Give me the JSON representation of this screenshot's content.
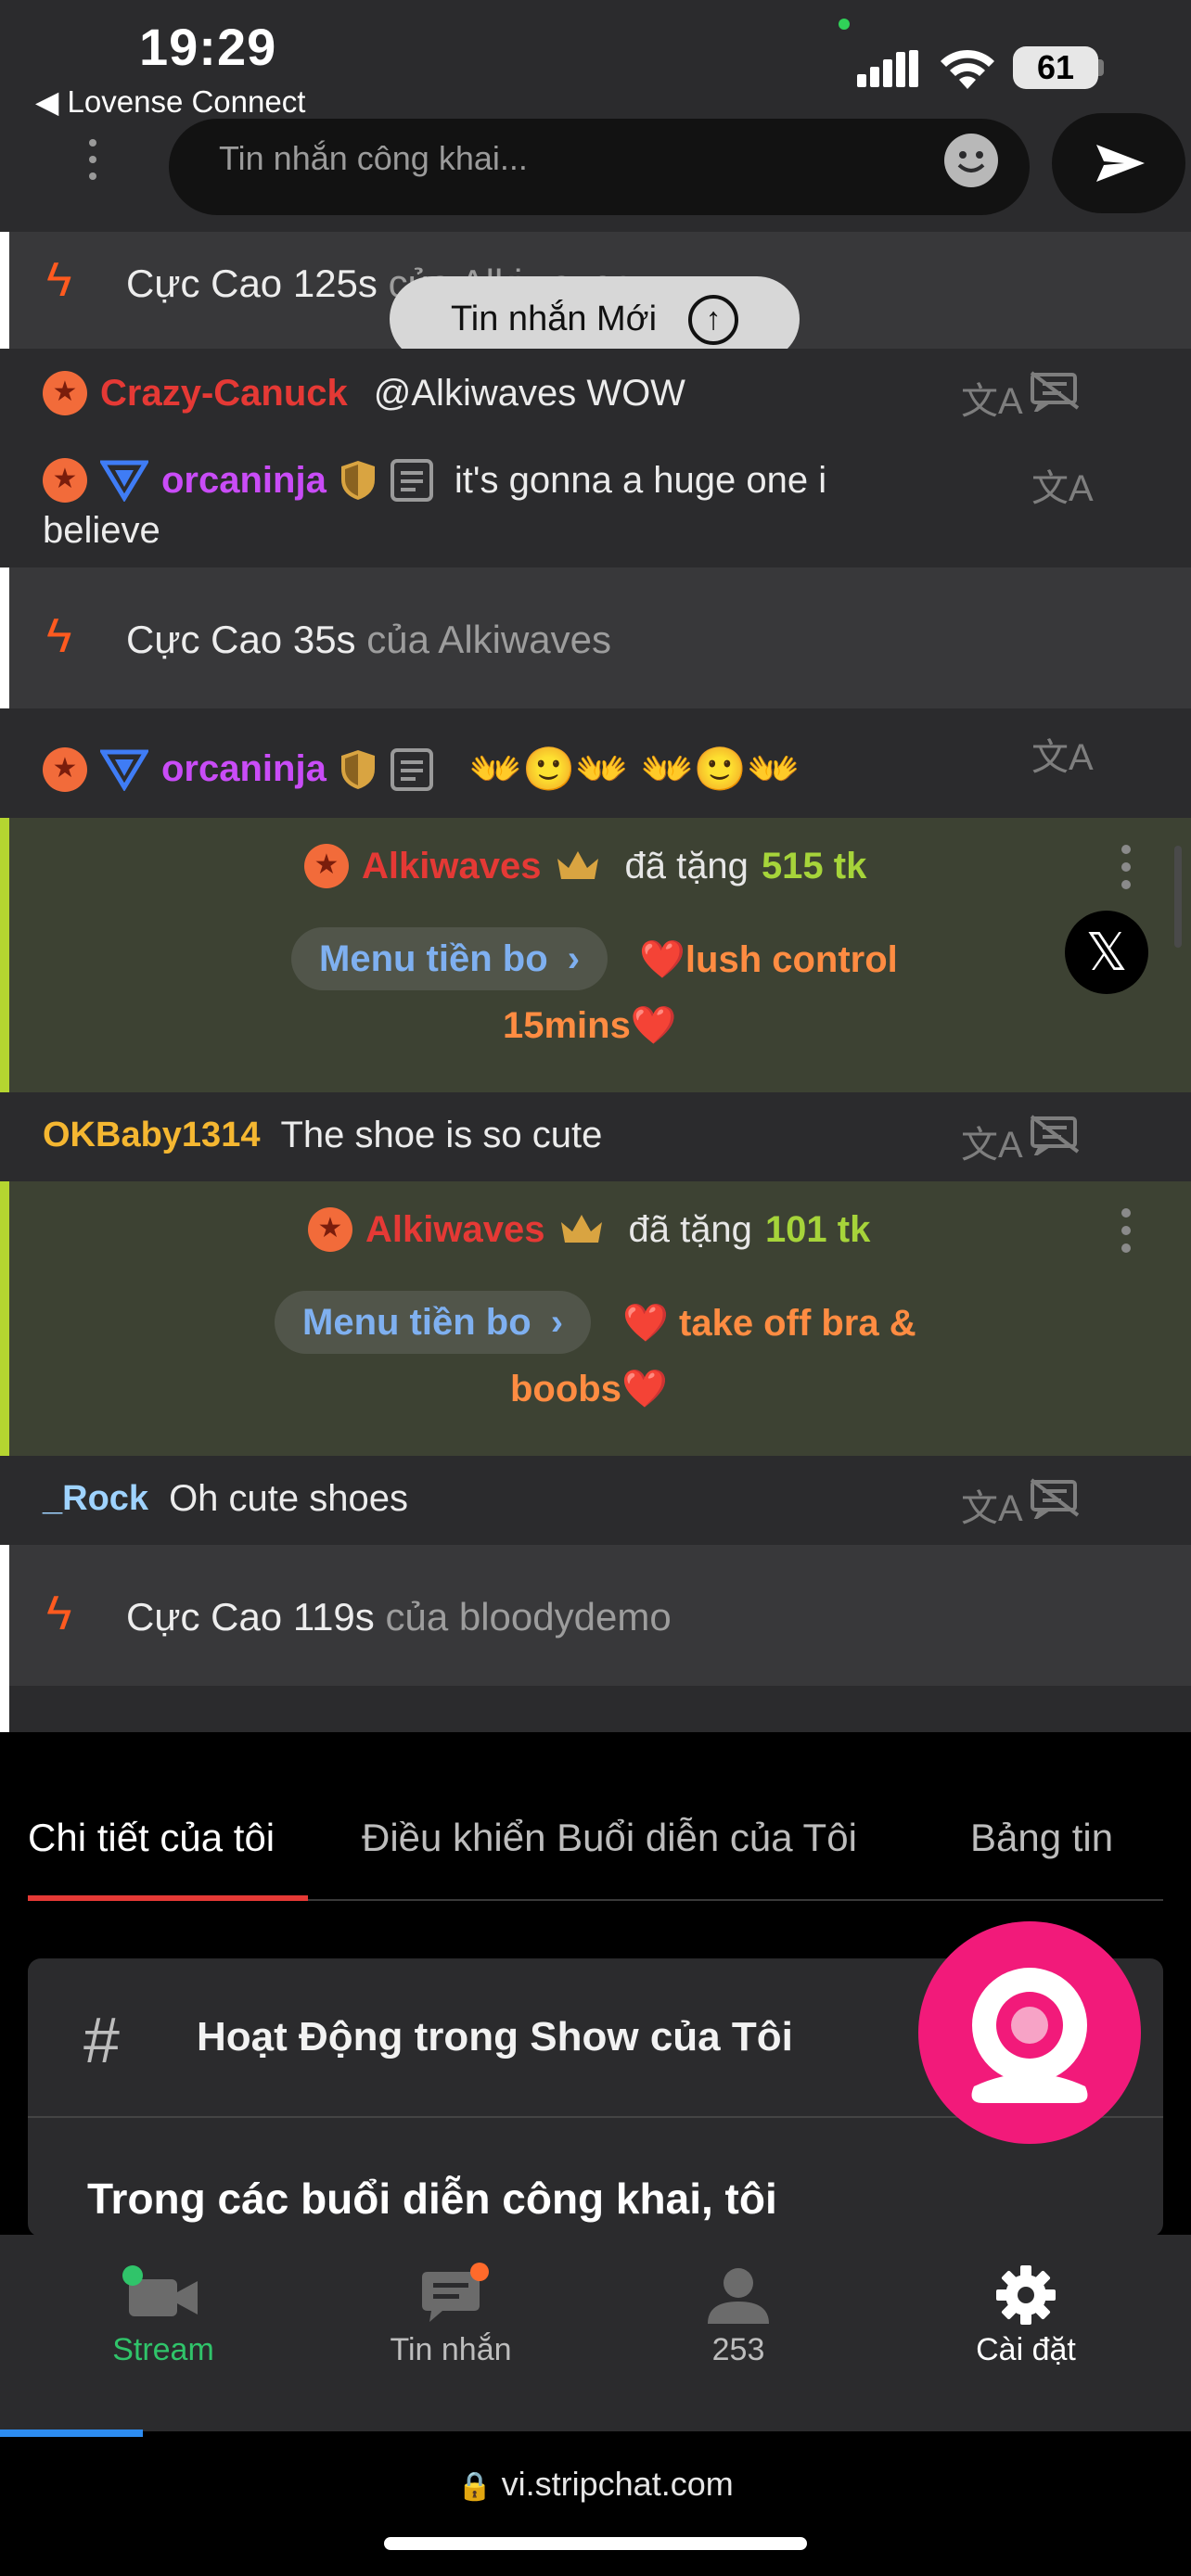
{
  "status_bar": {
    "time": "19:29",
    "back_app": "◀ Lovense Connect",
    "battery": "61"
  },
  "chat_input": {
    "placeholder": "Tin nhắn công khai..."
  },
  "toast": {
    "label": "Tin nhắn Mới"
  },
  "messages": {
    "sys1": {
      "text": "Cực Cao 125s",
      "of": "của Alkiwaves"
    },
    "m1": {
      "user": "Crazy-Canuck",
      "text": "@Alkiwaves  WOW"
    },
    "m2": {
      "user": "orcaninja",
      "text": "it's gonna a huge one i",
      "text2": "believe"
    },
    "sys2": {
      "text": "Cực Cao 35s",
      "of": "của Alkiwaves"
    },
    "m3": {
      "user": "orcaninja",
      "emoji": "👐🙂👐   👐🙂👐"
    },
    "tip1": {
      "user": "Alkiwaves",
      "gave": "đã tặng",
      "amount": "515 tk",
      "menu": "Menu tiền bo",
      "item": "❤️lush control",
      "item2": "15mins❤️"
    },
    "m4": {
      "user": "OKBaby1314",
      "text": "The shoe is so cute"
    },
    "tip2": {
      "user": "Alkiwaves",
      "gave": "đã tặng",
      "amount": "101 tk",
      "menu": "Menu tiền bo",
      "item": "❤️ take off bra &",
      "item2": "boobs❤️"
    },
    "m5": {
      "user": "_Rock",
      "text": "Oh cute shoes"
    },
    "sys3": {
      "text": "Cực Cao 119s",
      "of": "của bloodydemo"
    }
  },
  "tabs": [
    "Chi tiết của tôi",
    "Điều khiển Buổi diễn của Tôi",
    "Bảng tin"
  ],
  "card": {
    "title": "Hoạt Động trong Show của Tôi",
    "subtitle": "Trong các buổi diễn công khai, tôi"
  },
  "nav": {
    "stream": "Stream",
    "messages": "Tin nhắn",
    "count": "253",
    "settings": "Cài đặt"
  },
  "url": "vi.stripchat.com",
  "colors": {
    "accent_red": "#e53935",
    "stream_green": "#30c46a",
    "fab_pink": "#f21a7a",
    "tip_green": "#a6d43a"
  }
}
